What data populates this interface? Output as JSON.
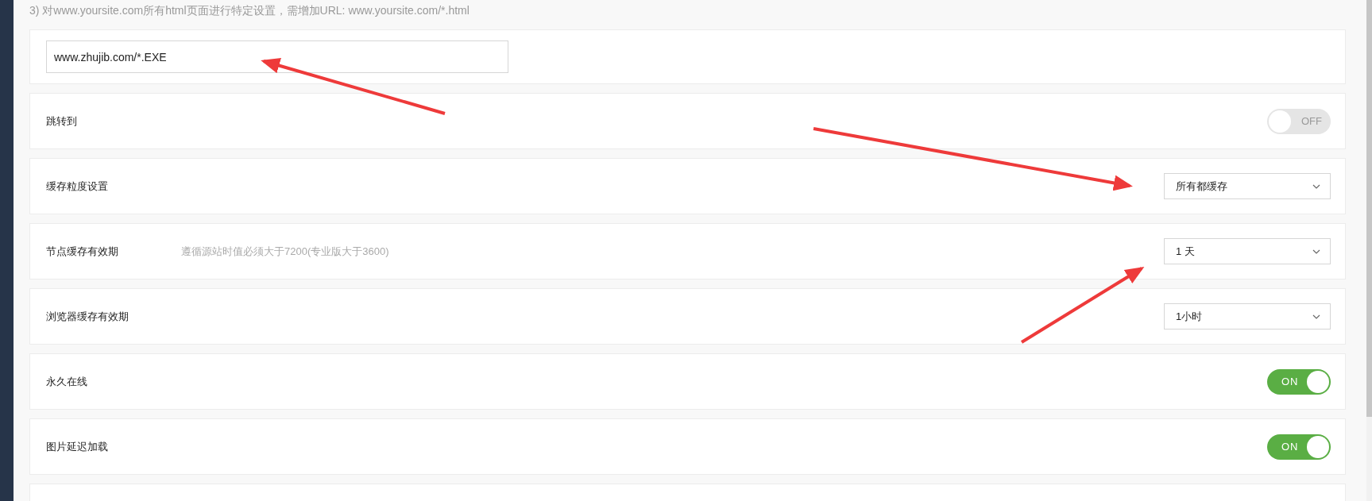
{
  "intro": "3) 对www.yoursite.com所有html页面进行特定设置，需增加URL: www.yoursite.com/*.html",
  "url_field": {
    "value": "www.zhujib.com/*.EXE"
  },
  "settings": [
    {
      "kind": "toggle",
      "label": "跳转到",
      "on": false,
      "state_text": "OFF"
    },
    {
      "kind": "select",
      "label": "缓存粒度设置",
      "value": "所有都缓存"
    },
    {
      "kind": "select",
      "label": "节点缓存有效期",
      "hint": "遵循源站时值必须大于7200(专业版大于3600)",
      "value": "1 天"
    },
    {
      "kind": "select",
      "label": "浏览器缓存有效期",
      "value": "1小时"
    },
    {
      "kind": "toggle",
      "label": "永久在线",
      "on": true,
      "state_text": "ON"
    },
    {
      "kind": "toggle",
      "label": "图片延迟加载",
      "on": true,
      "state_text": "ON"
    }
  ]
}
